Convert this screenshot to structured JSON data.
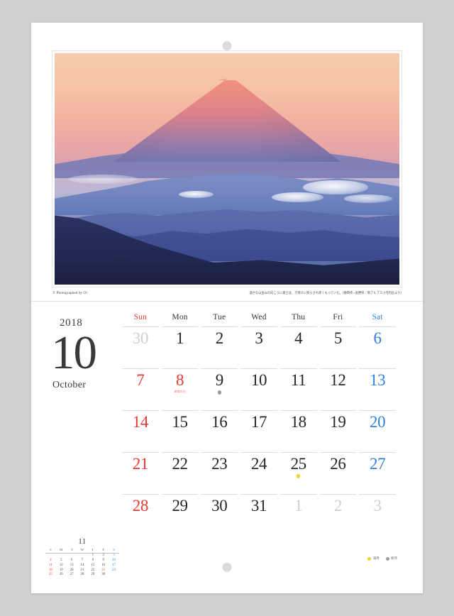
{
  "calendar": {
    "year": "2018",
    "month_number": "10",
    "month_name": "October",
    "weekday_headers": [
      "Sun",
      "Mon",
      "Tue",
      "Wed",
      "Thu",
      "Fri",
      "Sat"
    ],
    "weeks": [
      [
        {
          "num": "30",
          "kind": "out"
        },
        {
          "num": "1",
          "kind": "normal"
        },
        {
          "num": "2",
          "kind": "normal"
        },
        {
          "num": "3",
          "kind": "normal"
        },
        {
          "num": "4",
          "kind": "normal"
        },
        {
          "num": "5",
          "kind": "normal"
        },
        {
          "num": "6",
          "kind": "sat"
        }
      ],
      [
        {
          "num": "7",
          "kind": "sun"
        },
        {
          "num": "8",
          "kind": "hol",
          "holiday": "体育の日"
        },
        {
          "num": "9",
          "kind": "normal",
          "moon": "new"
        },
        {
          "num": "10",
          "kind": "normal"
        },
        {
          "num": "11",
          "kind": "normal"
        },
        {
          "num": "12",
          "kind": "normal"
        },
        {
          "num": "13",
          "kind": "sat"
        }
      ],
      [
        {
          "num": "14",
          "kind": "sun"
        },
        {
          "num": "15",
          "kind": "normal"
        },
        {
          "num": "16",
          "kind": "normal"
        },
        {
          "num": "17",
          "kind": "normal"
        },
        {
          "num": "18",
          "kind": "normal"
        },
        {
          "num": "19",
          "kind": "normal"
        },
        {
          "num": "20",
          "kind": "sat"
        }
      ],
      [
        {
          "num": "21",
          "kind": "sun"
        },
        {
          "num": "22",
          "kind": "normal"
        },
        {
          "num": "23",
          "kind": "normal"
        },
        {
          "num": "24",
          "kind": "normal"
        },
        {
          "num": "25",
          "kind": "normal",
          "moon": "full"
        },
        {
          "num": "26",
          "kind": "normal"
        },
        {
          "num": "27",
          "kind": "sat"
        }
      ],
      [
        {
          "num": "28",
          "kind": "sun"
        },
        {
          "num": "29",
          "kind": "normal"
        },
        {
          "num": "30",
          "kind": "normal"
        },
        {
          "num": "31",
          "kind": "normal"
        },
        {
          "num": "1",
          "kind": "out"
        },
        {
          "num": "2",
          "kind": "out"
        },
        {
          "num": "3",
          "kind": "out"
        }
      ]
    ]
  },
  "mini_calendar": {
    "title": "11",
    "weekday_headers": [
      "S",
      "M",
      "T",
      "W",
      "T",
      "F",
      "S"
    ],
    "weeks": [
      [
        {
          "num": "",
          "kind": "blank"
        },
        {
          "num": "",
          "kind": "blank"
        },
        {
          "num": "",
          "kind": "blank"
        },
        {
          "num": "",
          "kind": "blank"
        },
        {
          "num": "1",
          "kind": "normal"
        },
        {
          "num": "2",
          "kind": "normal"
        },
        {
          "num": "3",
          "kind": "sat hol"
        }
      ],
      [
        {
          "num": "4",
          "kind": "sun"
        },
        {
          "num": "5",
          "kind": "normal"
        },
        {
          "num": "6",
          "kind": "normal"
        },
        {
          "num": "7",
          "kind": "normal"
        },
        {
          "num": "8",
          "kind": "normal"
        },
        {
          "num": "9",
          "kind": "normal"
        },
        {
          "num": "10",
          "kind": "sat"
        }
      ],
      [
        {
          "num": "11",
          "kind": "sun"
        },
        {
          "num": "12",
          "kind": "normal"
        },
        {
          "num": "13",
          "kind": "normal"
        },
        {
          "num": "14",
          "kind": "normal"
        },
        {
          "num": "15",
          "kind": "normal"
        },
        {
          "num": "16",
          "kind": "normal"
        },
        {
          "num": "17",
          "kind": "sat"
        }
      ],
      [
        {
          "num": "18",
          "kind": "sun"
        },
        {
          "num": "19",
          "kind": "normal"
        },
        {
          "num": "20",
          "kind": "normal"
        },
        {
          "num": "21",
          "kind": "normal"
        },
        {
          "num": "22",
          "kind": "normal"
        },
        {
          "num": "23",
          "kind": "hol"
        },
        {
          "num": "24",
          "kind": "sat"
        }
      ],
      [
        {
          "num": "25",
          "kind": "sun"
        },
        {
          "num": "26",
          "kind": "normal"
        },
        {
          "num": "27",
          "kind": "normal"
        },
        {
          "num": "28",
          "kind": "normal"
        },
        {
          "num": "29",
          "kind": "normal"
        },
        {
          "num": "30",
          "kind": "normal"
        },
        {
          "num": "",
          "kind": "blank"
        }
      ]
    ]
  },
  "photo": {
    "credit": "© Photographed by Oi",
    "caption_jp": "遥かな山並みの向こうに富士は、夕焼けに照らされ赤くもっていた。(静岡県=長野県／南アルプス小河内岳より)",
    "alt_name": "mount-fuji-at-dawn"
  },
  "moon_legend": [
    {
      "phase": "full",
      "label": "満月"
    },
    {
      "phase": "new",
      "label": "新月"
    }
  ],
  "colors": {
    "sunday_red": "#e8392f",
    "saturday_blue": "#2f7fdd",
    "holiday_red": "#e8392f",
    "out_of_month_gray": "#cfcfcf",
    "full_moon_yellow": "#f2d22b",
    "new_moon_gray": "#9d9d9d",
    "page_background": "#ffffff",
    "backdrop_gray": "#d0d0d0"
  }
}
